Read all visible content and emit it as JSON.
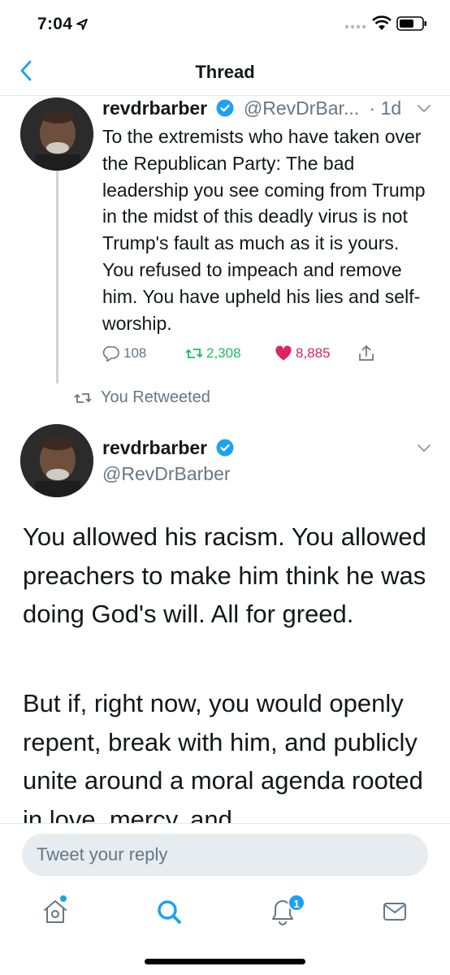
{
  "status_bar": {
    "time": "7:04"
  },
  "header": {
    "title": "Thread"
  },
  "tweet1": {
    "name": "revdrbarber",
    "handle": "@RevDrBar...",
    "age": "· 1d",
    "text": "To the extremists who have taken over the Republican Party: The bad leadership you see coming from Trump in the midst of this deadly virus is not Trump's fault as much as it is yours. You refused to impeach and remove him. You have upheld his lies and self-worship.",
    "replies": "108",
    "retweets": "2,308",
    "likes": "8,885"
  },
  "retweet_notice": "You Retweeted",
  "tweet2": {
    "name": "revdrbarber",
    "handle": "@RevDrBarber",
    "paragraph1": "You allowed his racism. You allowed preachers to make him think he was doing God's will. All for greed.",
    "paragraph2": "But if, right now, you would openly repent, break with him, and publicly unite around a moral agenda rooted in love, mercy, and"
  },
  "reply": {
    "placeholder": "Tweet your reply"
  },
  "tabbar": {
    "notifications_badge": "1"
  },
  "colors": {
    "accent": "#1da1f2",
    "retweet": "#17bf63",
    "like": "#e0245e",
    "secondary_text": "#657786"
  },
  "icons": [
    "location-arrow-icon",
    "signal-icon",
    "wifi-icon",
    "battery-icon",
    "back-chevron-icon",
    "verified-badge-icon",
    "chevron-down-icon",
    "reply-icon",
    "retweet-icon",
    "heart-icon",
    "share-icon",
    "home-icon",
    "search-icon",
    "bell-icon",
    "mail-icon"
  ]
}
